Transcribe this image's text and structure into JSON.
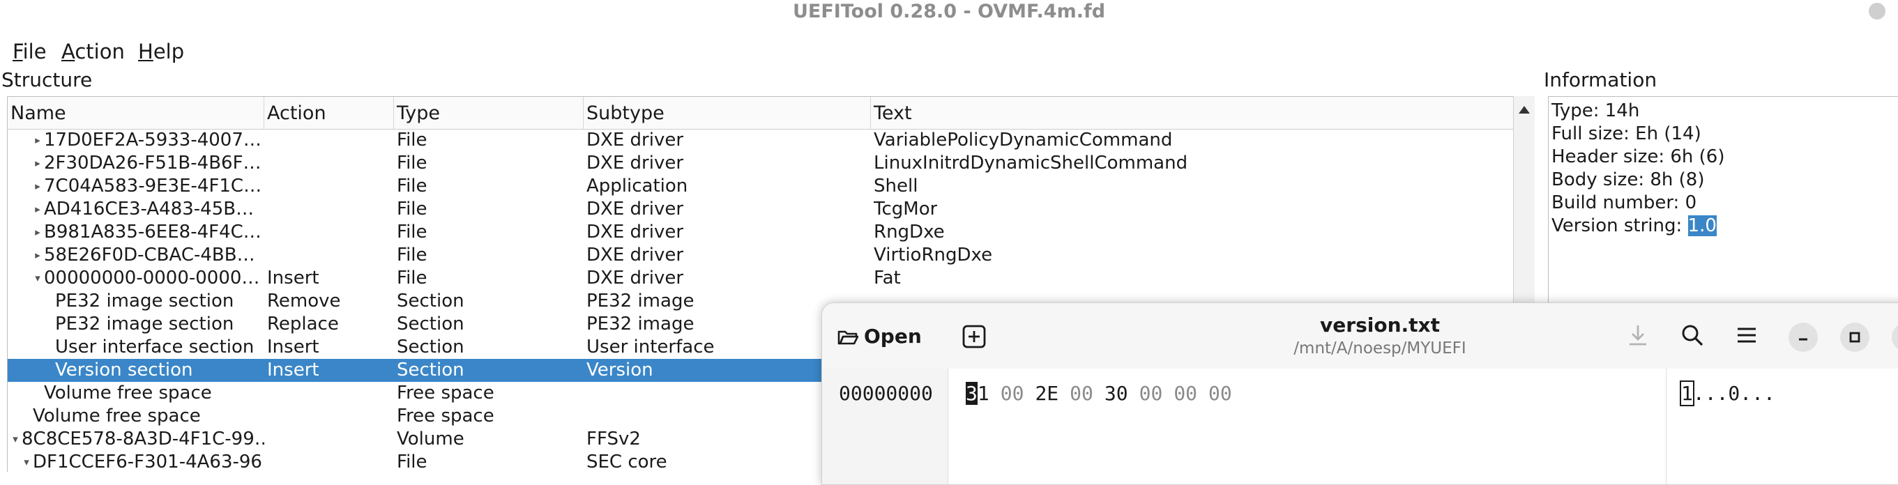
{
  "window": {
    "title": "UEFITool 0.28.0 - OVMF.4m.fd"
  },
  "menu": [
    {
      "accel": "F",
      "rest": "ile"
    },
    {
      "accel": "A",
      "rest": "ction"
    },
    {
      "accel": "H",
      "rest": "elp"
    }
  ],
  "structure": {
    "label": "Structure",
    "columns": [
      "Name",
      "Action",
      "Type",
      "Subtype",
      "Text"
    ],
    "rows": [
      {
        "name": "17D0EF2A-5933-4007…",
        "action": "",
        "type": "File",
        "subtype": "DXE driver",
        "text": "VariablePolicyDynamicCommand",
        "expander": "right",
        "indent": 2,
        "selected": false
      },
      {
        "name": "2F30DA26-F51B-4B6F…",
        "action": "",
        "type": "File",
        "subtype": "DXE driver",
        "text": "LinuxInitrdDynamicShellCommand",
        "expander": "right",
        "indent": 2,
        "selected": false
      },
      {
        "name": "7C04A583-9E3E-4F1C…",
        "action": "",
        "type": "File",
        "subtype": "Application",
        "text": "Shell",
        "expander": "right",
        "indent": 2,
        "selected": false
      },
      {
        "name": "AD416CE3-A483-45B…",
        "action": "",
        "type": "File",
        "subtype": "DXE driver",
        "text": "TcgMor",
        "expander": "right",
        "indent": 2,
        "selected": false
      },
      {
        "name": "B981A835-6EE8-4F4C…",
        "action": "",
        "type": "File",
        "subtype": "DXE driver",
        "text": "RngDxe",
        "expander": "right",
        "indent": 2,
        "selected": false
      },
      {
        "name": "58E26F0D-CBAC-4BB…",
        "action": "",
        "type": "File",
        "subtype": "DXE driver",
        "text": "VirtioRngDxe",
        "expander": "right",
        "indent": 2,
        "selected": false
      },
      {
        "name": "00000000-0000-0000…",
        "action": "Insert",
        "type": "File",
        "subtype": "DXE driver",
        "text": "Fat",
        "expander": "down",
        "indent": 2,
        "selected": false
      },
      {
        "name": "PE32 image section",
        "action": "Remove",
        "type": "Section",
        "subtype": "PE32 image",
        "text": "",
        "expander": "",
        "indent": 3,
        "selected": false
      },
      {
        "name": "PE32 image section",
        "action": "Replace",
        "type": "Section",
        "subtype": "PE32 image",
        "text": "",
        "expander": "",
        "indent": 3,
        "selected": false
      },
      {
        "name": "User interface section",
        "action": "Insert",
        "type": "Section",
        "subtype": "User interface",
        "text": "",
        "expander": "",
        "indent": 3,
        "selected": false
      },
      {
        "name": "Version section",
        "action": "Insert",
        "type": "Section",
        "subtype": "Version",
        "text": "",
        "expander": "",
        "indent": 3,
        "selected": true
      },
      {
        "name": "Volume free space",
        "action": "",
        "type": "Free space",
        "subtype": "",
        "text": "",
        "expander": "",
        "indent": 2,
        "selected": false
      },
      {
        "name": "Volume free space",
        "action": "",
        "type": "Free space",
        "subtype": "",
        "text": "",
        "expander": "",
        "indent": 1,
        "selected": false
      },
      {
        "name": "8C8CE578-8A3D-4F1C-99…",
        "action": "",
        "type": "Volume",
        "subtype": "FFSv2",
        "text": "",
        "expander": "down",
        "indent": 0,
        "selected": false
      },
      {
        "name": "DF1CCEF6-F301-4A63-96…",
        "action": "",
        "type": "File",
        "subtype": "SEC core",
        "text": "",
        "expander": "down",
        "indent": 1,
        "selected": false
      }
    ]
  },
  "information": {
    "label": "Information",
    "lines": [
      {
        "key": "Type:",
        "value": "14h",
        "highlight": false
      },
      {
        "key": "Full size:",
        "value": "Eh (14)",
        "highlight": false
      },
      {
        "key": "Header size:",
        "value": "6h (6)",
        "highlight": false
      },
      {
        "key": "Body size:",
        "value": "8h (8)",
        "highlight": false
      },
      {
        "key": "Build number:",
        "value": "0",
        "highlight": false
      },
      {
        "key": "Version string:",
        "value": "1.0",
        "highlight": true
      }
    ]
  },
  "hex_editor": {
    "open_label": "Open",
    "filename": "version.txt",
    "path": "/mnt/A/noesp/MYUEFI",
    "offset": "00000000",
    "bytes": [
      "31",
      "00",
      "2E",
      "00",
      "30",
      "00",
      "00",
      "00"
    ],
    "cursor_index": 0,
    "ascii": "1...0..."
  }
}
